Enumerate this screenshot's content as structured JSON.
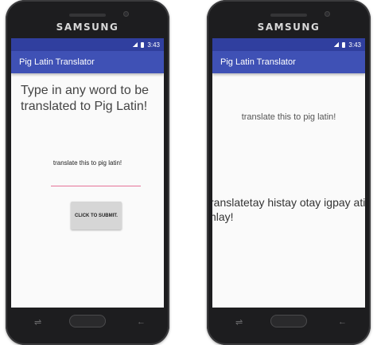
{
  "phones": [
    {
      "brand": "SAMSUNG",
      "status_time": "3:43",
      "app_title": "Pig Latin Translator",
      "prompt": "Type in any word to be translated to Pig Latin!",
      "input_text": "translate this to pig latin!",
      "button_label": "CLICK TO SUBMIT."
    },
    {
      "brand": "SAMSUNG",
      "status_time": "3:43",
      "app_title": "Pig Latin Translator",
      "original_text": "translate this to pig latin!",
      "translation": "ranslatetay histay otay igpay atinlay!"
    }
  ],
  "colors": {
    "status_bar": "#303f9f",
    "app_bar": "#3f51b5",
    "input_underline": "#e57399",
    "button_bg": "#d6d6d6"
  },
  "icons": {
    "signal": "signal-icon",
    "battery": "battery-icon",
    "recent": "recent-apps-icon",
    "home": "home-button-icon",
    "back": "back-arrow-icon"
  }
}
